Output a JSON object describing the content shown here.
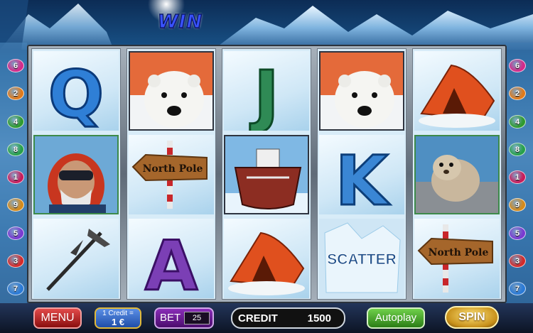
{
  "title": "WIN",
  "reels": [
    [
      {
        "symbol": "Q",
        "kind": "letter",
        "color": "#2f7fd6"
      },
      {
        "symbol": "climber",
        "kind": "picture"
      },
      {
        "symbol": "ice-axe",
        "kind": "picture"
      }
    ],
    [
      {
        "symbol": "polar-bear",
        "kind": "picture"
      },
      {
        "symbol": "north-pole-sign",
        "kind": "picture",
        "text": "North Pole"
      },
      {
        "symbol": "A",
        "kind": "letter",
        "color": "#7b3fb5"
      }
    ],
    [
      {
        "symbol": "J",
        "kind": "letter",
        "color": "#2f8a55"
      },
      {
        "symbol": "icebreaker-ship",
        "kind": "picture"
      },
      {
        "symbol": "tent",
        "kind": "picture"
      }
    ],
    [
      {
        "symbol": "polar-bear",
        "kind": "picture"
      },
      {
        "symbol": "K",
        "kind": "letter",
        "color": "#3a86d4"
      },
      {
        "symbol": "scatter",
        "kind": "picture",
        "text": "SCATTER"
      }
    ],
    [
      {
        "symbol": "tent",
        "kind": "picture"
      },
      {
        "symbol": "seal",
        "kind": "picture"
      },
      {
        "symbol": "north-pole-sign",
        "kind": "picture",
        "text": "North Pole"
      }
    ]
  ],
  "paylines_left": [
    {
      "num": "6",
      "color": "#d42a8a"
    },
    {
      "num": "2",
      "color": "#e07a1a"
    },
    {
      "num": "4",
      "color": "#2f9a2f"
    },
    {
      "num": "8",
      "color": "#27a04a"
    },
    {
      "num": "1",
      "color": "#c81c5a"
    },
    {
      "num": "9",
      "color": "#d48a1a"
    },
    {
      "num": "5",
      "color": "#7a3ad0"
    },
    {
      "num": "3",
      "color": "#d42a2a"
    },
    {
      "num": "7",
      "color": "#2a7ad6"
    }
  ],
  "paylines_right": [
    {
      "num": "6",
      "color": "#d42a8a"
    },
    {
      "num": "2",
      "color": "#e07a1a"
    },
    {
      "num": "4",
      "color": "#2f9a2f"
    },
    {
      "num": "8",
      "color": "#27a04a"
    },
    {
      "num": "1",
      "color": "#c81c5a"
    },
    {
      "num": "9",
      "color": "#d48a1a"
    },
    {
      "num": "5",
      "color": "#7a3ad0"
    },
    {
      "num": "3",
      "color": "#d42a2a"
    },
    {
      "num": "7",
      "color": "#2a7ad6"
    }
  ],
  "controls": {
    "menu_label": "MENU",
    "credit_value_line1": "1 Credit =",
    "credit_value_line2": "1 €",
    "bet_label": "BET",
    "bet_value": "25",
    "credit_label": "CREDIT",
    "credit_value": "1500",
    "autoplay_label": "Autoplay",
    "spin_label": "SPIN"
  }
}
